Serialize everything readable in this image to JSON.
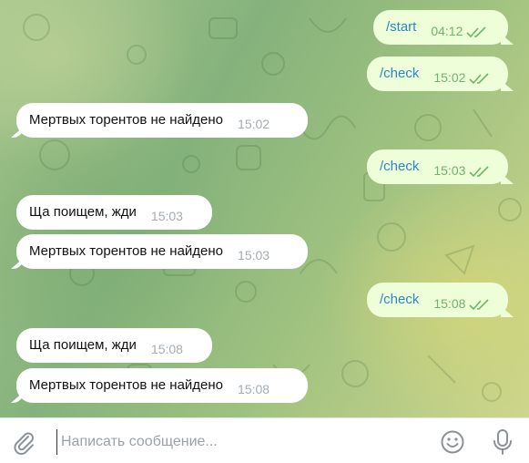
{
  "messages": [
    {
      "dir": "out",
      "text": "/start",
      "time": "04:12"
    },
    {
      "dir": "out",
      "text": "/check",
      "time": "15:02"
    },
    {
      "dir": "in",
      "text": "Мертвых торентов не найдено",
      "time": "15:02"
    },
    {
      "dir": "out",
      "text": "/check",
      "time": "15:03"
    },
    {
      "dir": "in",
      "text": "Ща поищем, жди",
      "time": "15:03"
    },
    {
      "dir": "in",
      "text": "Мертвых торентов не найдено",
      "time": "15:03"
    },
    {
      "dir": "out",
      "text": "/check",
      "time": "15:08"
    },
    {
      "dir": "in",
      "text": "Ща поищем, жди",
      "time": "15:08"
    },
    {
      "dir": "in",
      "text": "Мертвых торентов не найдено",
      "time": "15:08"
    }
  ],
  "composer": {
    "placeholder": "Написать сообщение...",
    "attach_icon": "paperclip-icon",
    "emoji_icon": "smile-icon",
    "mic_icon": "microphone-icon"
  },
  "colors": {
    "incoming_bubble": "#ffffff",
    "outgoing_bubble": "#eefed9",
    "command_link": "#2d86c5",
    "read_checks": "#6fb36b"
  }
}
